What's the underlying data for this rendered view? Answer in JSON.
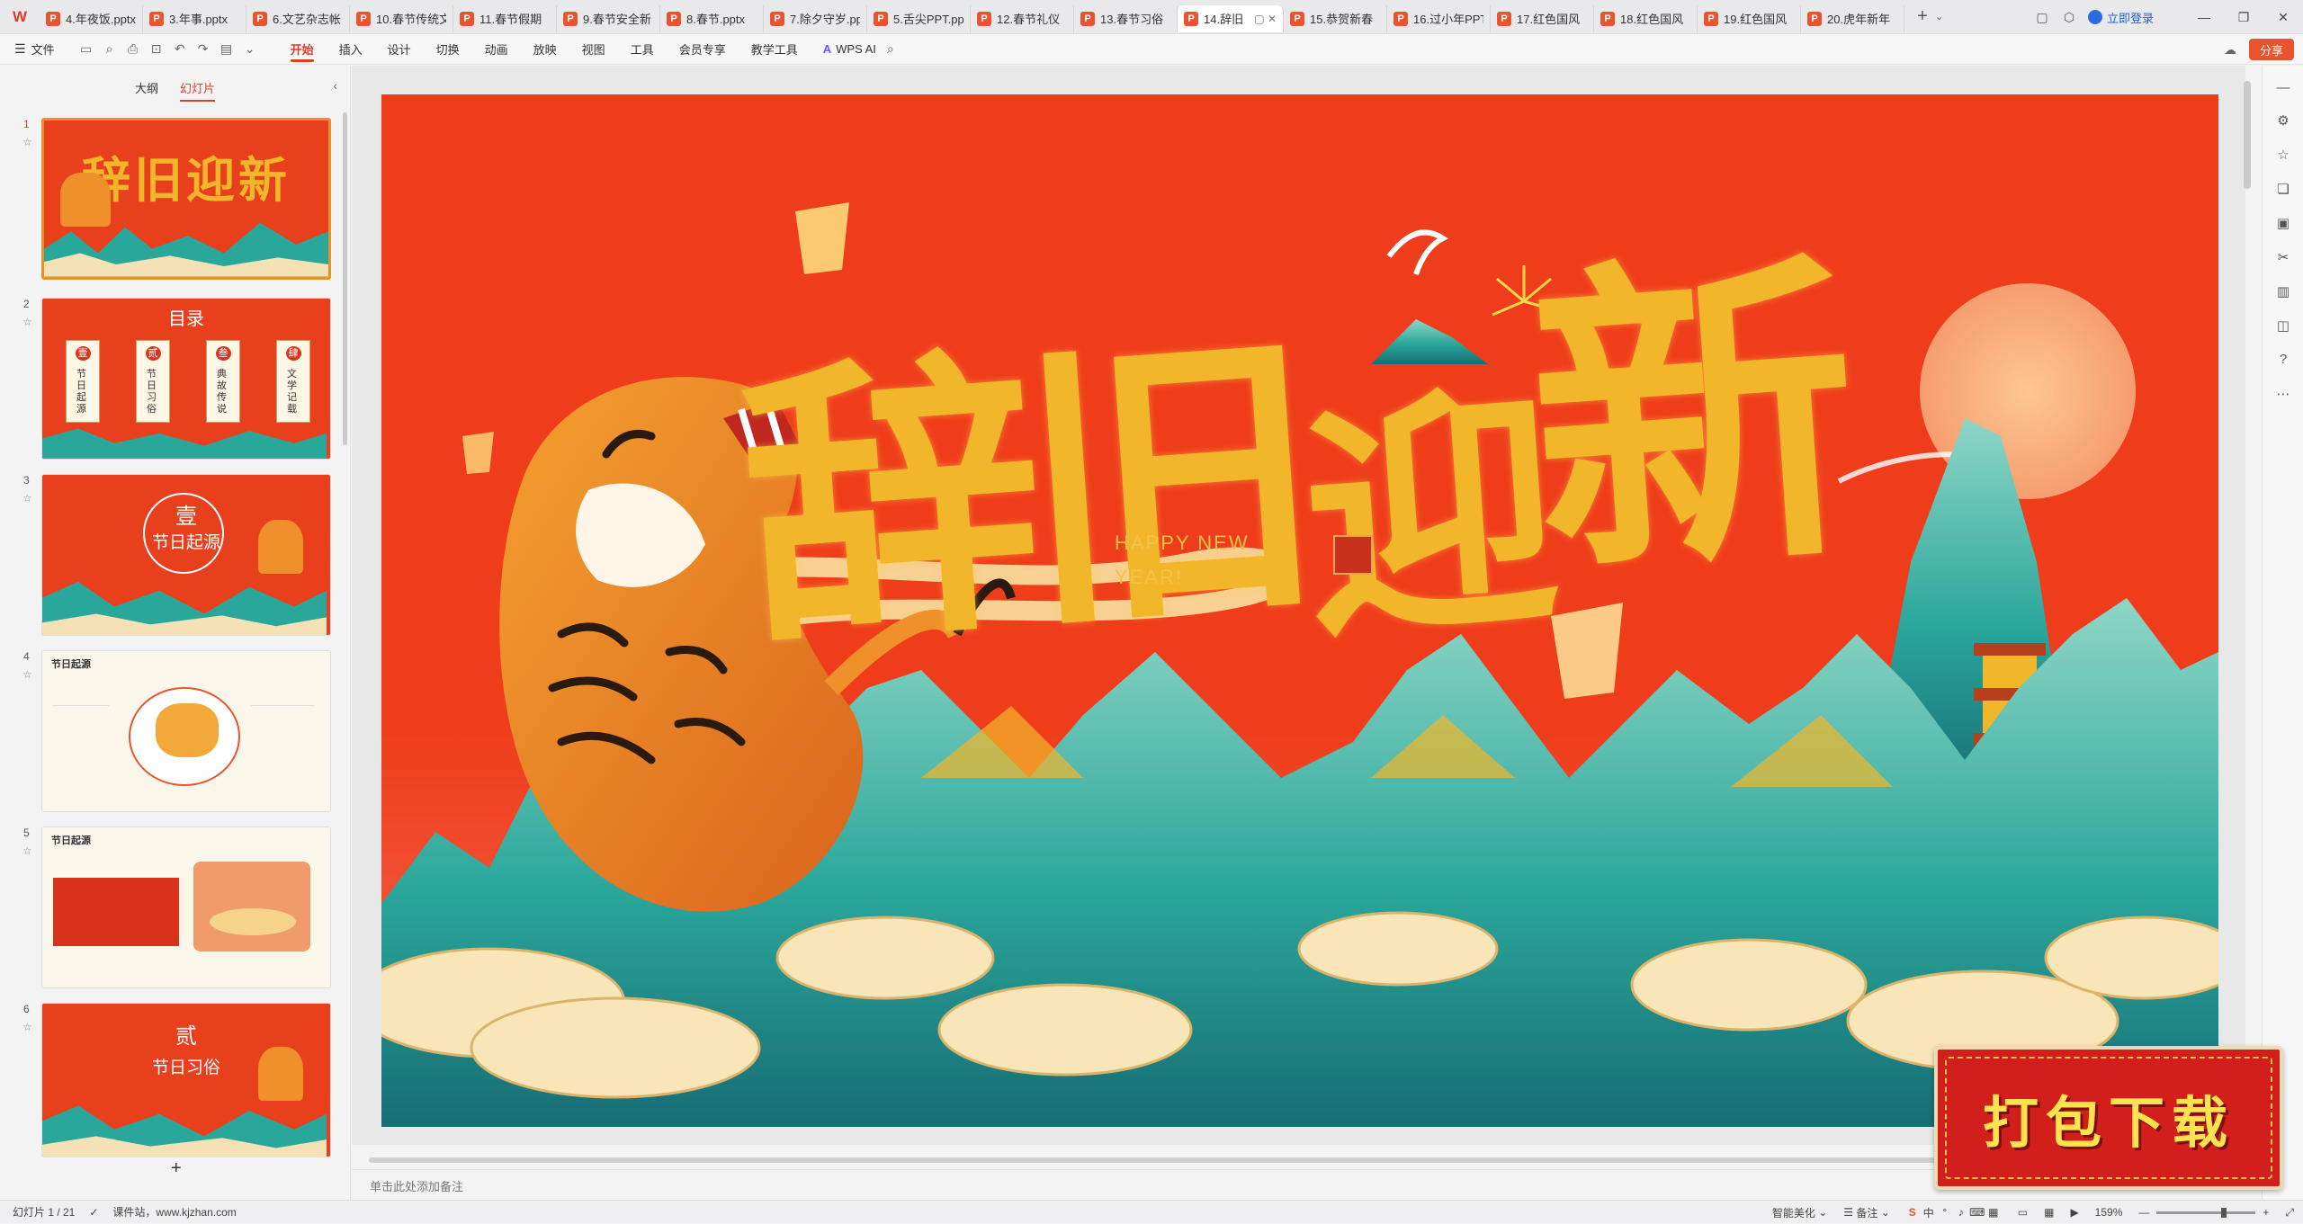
{
  "app": {
    "logo": "W",
    "tabs": [
      {
        "label": "4.年夜饭.pptx",
        "active": false
      },
      {
        "label": "3.年事.pptx",
        "active": false
      },
      {
        "label": "6.文艺杂志帐",
        "active": false
      },
      {
        "label": "10.春节传统文",
        "active": false
      },
      {
        "label": "11.春节假期",
        "active": false
      },
      {
        "label": "9.春节安全新",
        "active": false
      },
      {
        "label": "8.春节.pptx",
        "active": false
      },
      {
        "label": "7.除夕守岁.pp",
        "active": false
      },
      {
        "label": "5.舌尖PPT.pp",
        "active": false
      },
      {
        "label": "12.春节礼仪",
        "active": false
      },
      {
        "label": "13.春节习俗",
        "active": false
      },
      {
        "label": "14.辞旧",
        "active": true
      },
      {
        "label": "15.恭贺新春",
        "active": false
      },
      {
        "label": "16.过小年PPT",
        "active": false
      },
      {
        "label": "17.红色国风",
        "active": false
      },
      {
        "label": "18.红色国风",
        "active": false
      },
      {
        "label": "19.红色国风",
        "active": false
      },
      {
        "label": "20.虎年新年",
        "active": false
      }
    ],
    "tab_icon_letter": "P",
    "login_label": "立即登录"
  },
  "ribbon": {
    "file_label": "文件",
    "tabs": [
      "开始",
      "插入",
      "设计",
      "切换",
      "动画",
      "放映",
      "视图",
      "工具",
      "会员专享",
      "教学工具"
    ],
    "active_tab": "开始",
    "wps_ai_label": "WPS AI",
    "share_label": "分享"
  },
  "left_panel": {
    "tabs": [
      "大纲",
      "幻灯片"
    ],
    "active_tab": "幻灯片",
    "slides": [
      {
        "number": "1",
        "title": "辞旧迎新"
      },
      {
        "number": "2",
        "title": "目录",
        "items": [
          "节日起源",
          "节日习俗",
          "典故传说",
          "文学记载"
        ],
        "marks": [
          "壹",
          "贰",
          "叁",
          "肆"
        ]
      },
      {
        "number": "3",
        "title": "节日起源",
        "mark": "壹"
      },
      {
        "number": "4",
        "title": "节日起源"
      },
      {
        "number": "5",
        "title": "节日起源"
      },
      {
        "number": "6",
        "title": "节日习俗",
        "mark": "贰"
      }
    ],
    "active_slide": "1"
  },
  "slide": {
    "title_calligraphy": [
      "辞",
      "旧",
      "迎",
      "新"
    ],
    "english_line1": "HAPPY NEW",
    "english_line2": "YEAR!",
    "colors": {
      "background": "#ef3c1a",
      "gold": "#f2b62a",
      "teal": "#2aa79b"
    }
  },
  "notes_placeholder": "单击此处添加备注",
  "status": {
    "slide_indicator": "幻灯片 1 / 21",
    "source": "课件站，www.kjzhan.com",
    "smart_beautify": "智能美化",
    "notes_label": "备注",
    "zoom": "159%"
  },
  "download_banner": "打包下载"
}
